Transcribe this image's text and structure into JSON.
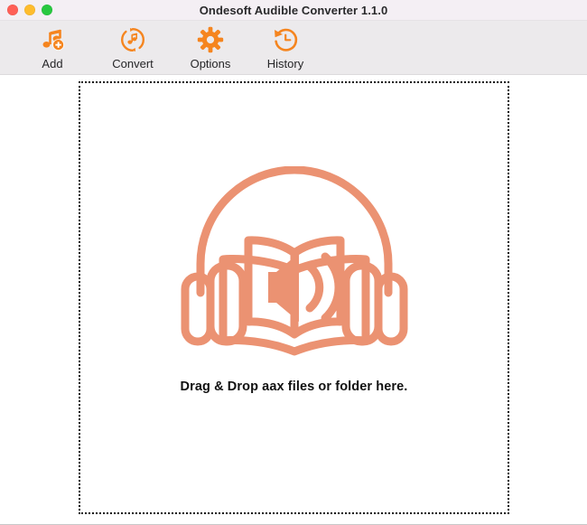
{
  "window": {
    "title": "Ondesoft Audible Converter 1.1.0",
    "traffic_lights": [
      {
        "name": "close",
        "color": "#ff5f57"
      },
      {
        "name": "minimize",
        "color": "#febc2e"
      },
      {
        "name": "maximize",
        "color": "#28c840"
      }
    ]
  },
  "toolbar": {
    "accent_color": "#f5851f",
    "items": [
      {
        "label": "Add",
        "icon": "music-note-add-icon"
      },
      {
        "label": "Convert",
        "icon": "convert-refresh-icon"
      },
      {
        "label": "Options",
        "icon": "gear-icon"
      },
      {
        "label": "History",
        "icon": "clock-history-icon"
      }
    ]
  },
  "dropzone": {
    "icon": "audiobook-headphones-icon",
    "icon_color": "#eb9272",
    "message": "Drag & Drop aax files or folder here.",
    "border_style": "dotted",
    "border_color": "#111111"
  }
}
